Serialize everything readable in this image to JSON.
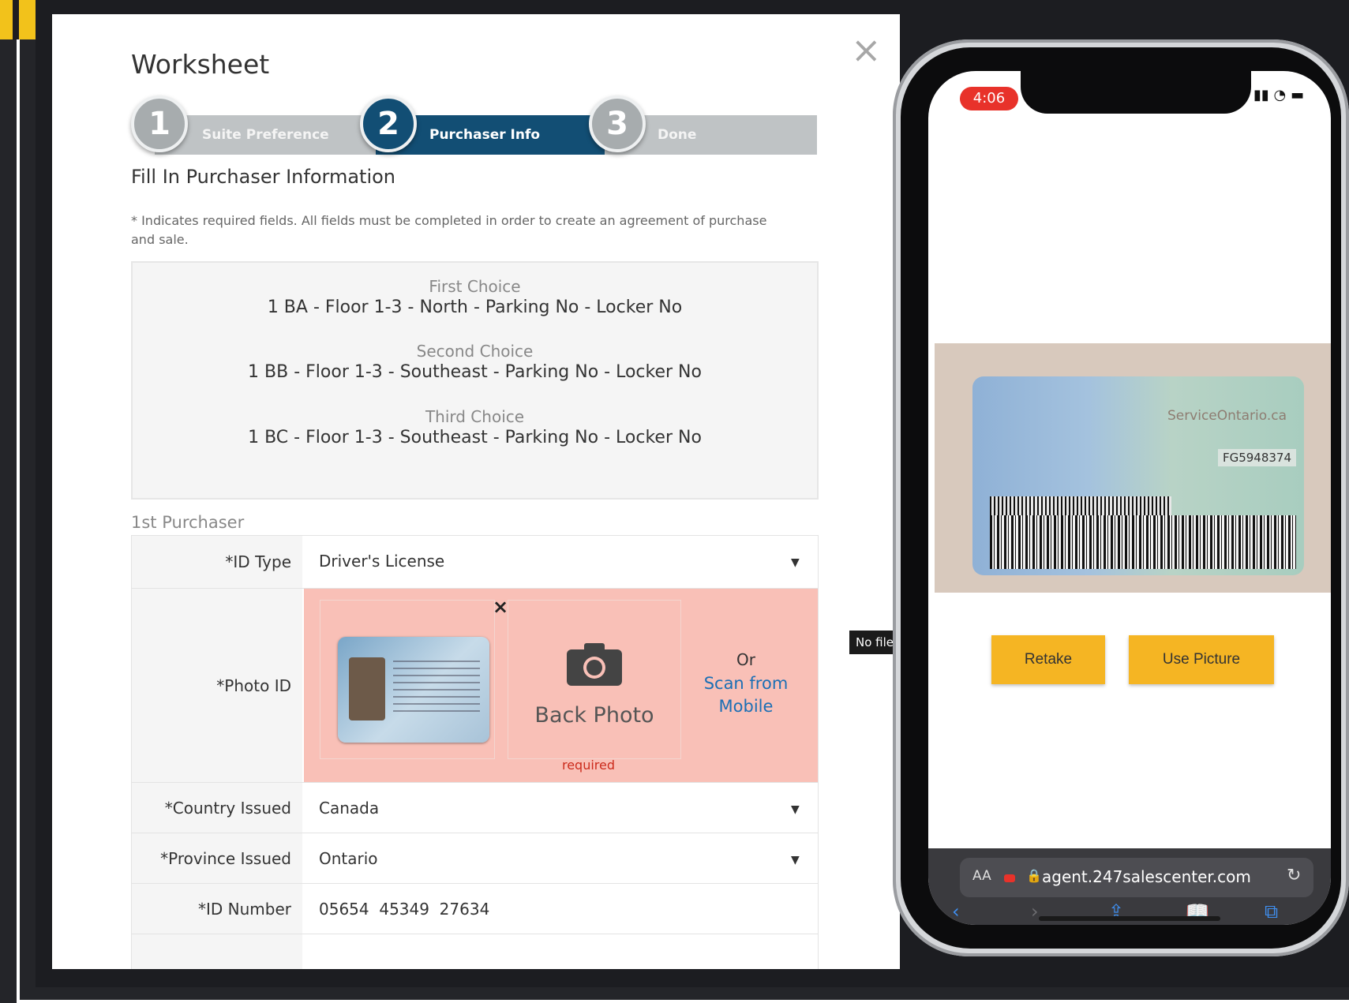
{
  "modal": {
    "title": "Worksheet",
    "close_glyph": "×",
    "steps": [
      {
        "number": "1",
        "label": "Suite Preference"
      },
      {
        "number": "2",
        "label": "Purchaser Info"
      },
      {
        "number": "3",
        "label": "Done"
      }
    ],
    "section_title": "Fill In Purchaser Information",
    "required_note": "* Indicates required fields. All fields must be completed in order to create an agreement of purchase and sale.",
    "choices": [
      {
        "label": "First Choice",
        "value": "1 BA - Floor 1-3 - North - Parking No - Locker No"
      },
      {
        "label": "Second Choice",
        "value": "1 BB - Floor 1-3 - Southeast - Parking No - Locker No"
      },
      {
        "label": "Third Choice",
        "value": "1 BC - Floor 1-3 - Southeast - Parking No - Locker No"
      }
    ],
    "purchaser_heading": "1st Purchaser",
    "form": {
      "id_type": {
        "label": "*ID Type",
        "value": "Driver's License"
      },
      "photo_id": {
        "label": "*Photo ID",
        "remove_glyph": "×",
        "back_photo_label": "Back Photo",
        "required_text": "required",
        "or_text": "Or",
        "scan_link": "Scan from Mobile"
      },
      "country_issued": {
        "label": "*Country Issued",
        "value": "Canada"
      },
      "province_issued": {
        "label": "*Province Issued",
        "value": "Ontario"
      },
      "id_number": {
        "label": "*ID Number",
        "value": "05654  45349  27634"
      }
    },
    "caret_glyph": "▼"
  },
  "tooltip": {
    "text": "No file"
  },
  "phone": {
    "time": "4:06",
    "status_icons": "▮▮ ◔ ▬",
    "license": {
      "site": "ServiceOntario.ca",
      "number": "FG5948374"
    },
    "retake_label": "Retake",
    "use_picture_label": "Use Picture",
    "browser": {
      "aa_label": "AA",
      "lock_glyph": "🔒",
      "url": "agent.247salescenter.com",
      "reload_glyph": "↻",
      "nav": {
        "back": "‹",
        "forward": "›",
        "share": "⇪",
        "bookmarks": "📖",
        "tabs": "⧉"
      }
    }
  },
  "colors": {
    "step_active": "#124e74",
    "step_inactive": "#a7acae",
    "photo_area_bg": "#f9c0b7",
    "link": "#1b6fb5",
    "required_red": "#cc2b1c",
    "phone_button": "#f5b523"
  }
}
